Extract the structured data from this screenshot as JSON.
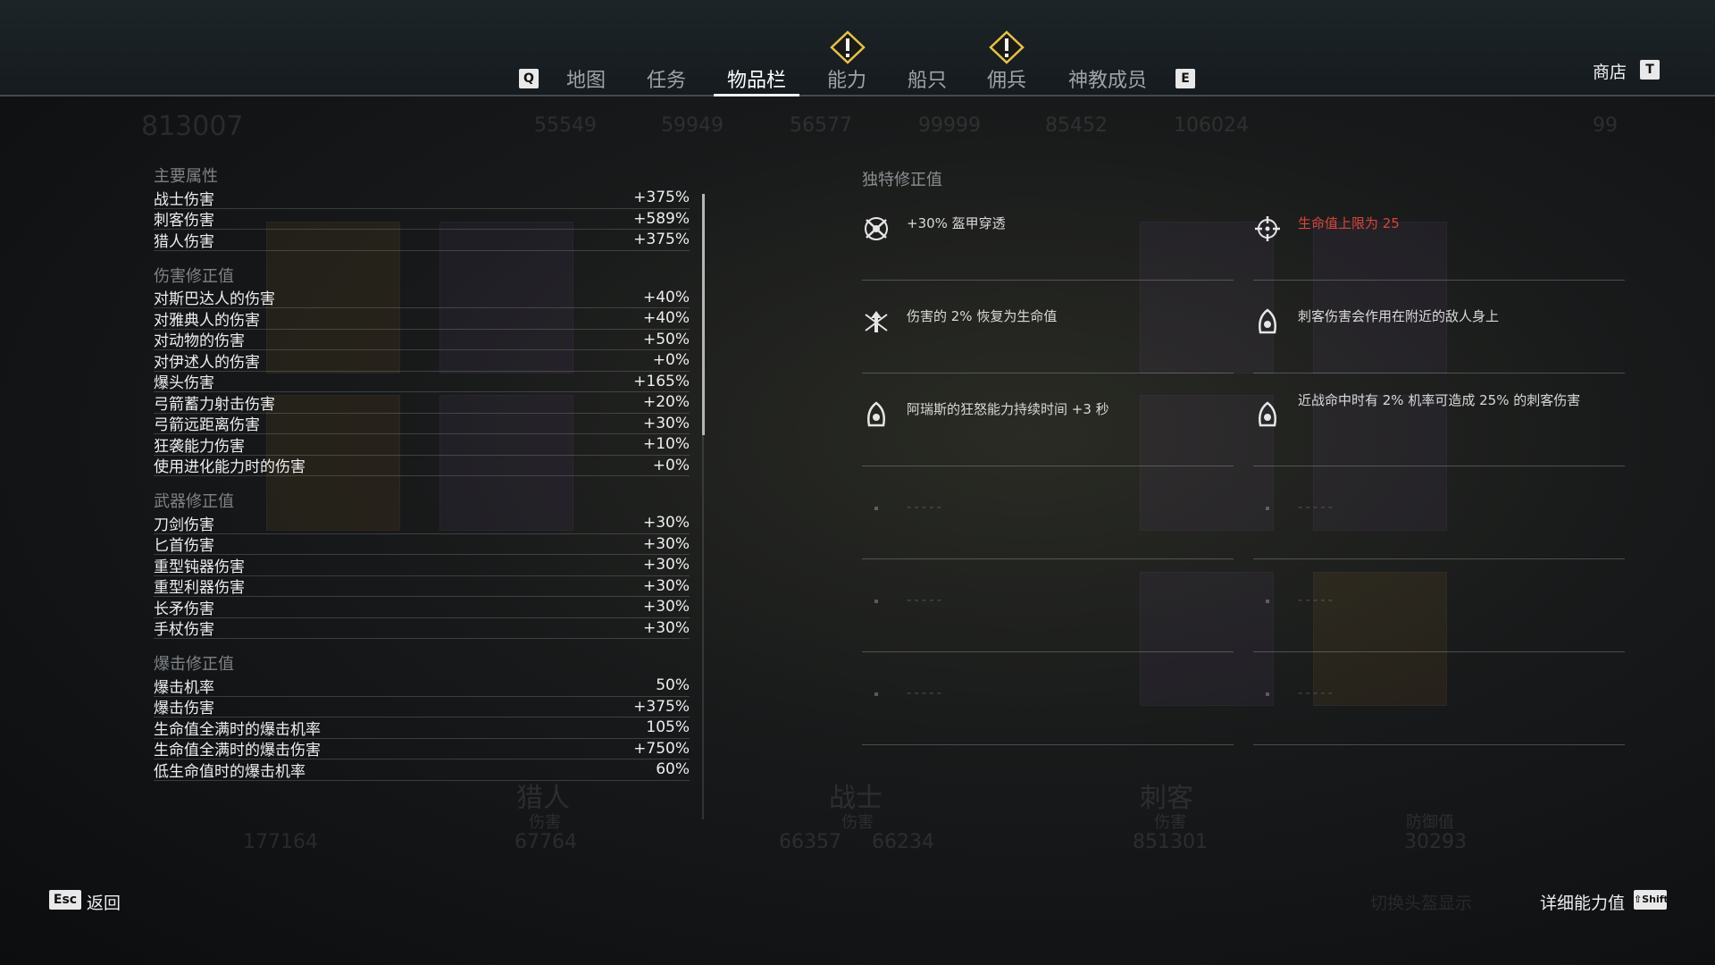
{
  "nav": {
    "left_key": "Q",
    "right_key": "E",
    "tabs": [
      {
        "label": "地图",
        "active": false,
        "alert": false
      },
      {
        "label": "任务",
        "active": false,
        "alert": false
      },
      {
        "label": "物品栏",
        "active": true,
        "alert": false
      },
      {
        "label": "能力",
        "active": false,
        "alert": true
      },
      {
        "label": "船只",
        "active": false,
        "alert": false
      },
      {
        "label": "佣兵",
        "active": false,
        "alert": true
      },
      {
        "label": "神教成员",
        "active": false,
        "alert": false
      }
    ],
    "shop_label": "商店",
    "shop_key": "T"
  },
  "background_stats": {
    "top": [
      "813007",
      "55549",
      "59949",
      "56577",
      "99999",
      "85452",
      "106024"
    ],
    "bottom_labels": [
      "猎人",
      "战士",
      "刺客"
    ],
    "bottom_sub": [
      "伤害",
      "伤害",
      "伤害",
      "防御值"
    ],
    "bottom_values": [
      "177164",
      "67764",
      "66357",
      "66234",
      "851301",
      "30293"
    ],
    "level_badge": "99"
  },
  "stats": {
    "sections": [
      {
        "title": "主要属性",
        "rows": [
          {
            "label": "战士伤害",
            "value": "+375%"
          },
          {
            "label": "刺客伤害",
            "value": "+589%"
          },
          {
            "label": "猎人伤害",
            "value": "+375%"
          }
        ]
      },
      {
        "title": "伤害修正值",
        "rows": [
          {
            "label": "对斯巴达人的伤害",
            "value": "+40%"
          },
          {
            "label": "对雅典人的伤害",
            "value": "+40%"
          },
          {
            "label": "对动物的伤害",
            "value": "+50%"
          },
          {
            "label": "对伊述人的伤害",
            "value": "+0%"
          },
          {
            "label": "爆头伤害",
            "value": "+165%"
          },
          {
            "label": "弓箭蓄力射击伤害",
            "value": "+20%"
          },
          {
            "label": "弓箭远距离伤害",
            "value": "+30%"
          },
          {
            "label": "狂袭能力伤害",
            "value": "+10%"
          },
          {
            "label": "使用进化能力时的伤害",
            "value": "+0%"
          }
        ]
      },
      {
        "title": "武器修正值",
        "rows": [
          {
            "label": "刀剑伤害",
            "value": "+30%"
          },
          {
            "label": "匕首伤害",
            "value": "+30%"
          },
          {
            "label": "重型钝器伤害",
            "value": "+30%"
          },
          {
            "label": "重型利器伤害",
            "value": "+30%"
          },
          {
            "label": "长矛伤害",
            "value": "+30%"
          },
          {
            "label": "手杖伤害",
            "value": "+30%"
          }
        ]
      },
      {
        "title": "爆击修正值",
        "rows": [
          {
            "label": "爆击机率",
            "value": "50%"
          },
          {
            "label": "爆击伤害",
            "value": "+375%"
          },
          {
            "label": "生命值全满时的爆击机率",
            "value": "105%"
          },
          {
            "label": "生命值全满时的爆击伤害",
            "value": "+750%"
          },
          {
            "label": "低生命值时的爆击机率",
            "value": "60%"
          }
        ]
      }
    ]
  },
  "unique_modifiers": {
    "title": "独特修正值",
    "items": [
      {
        "text": "+30% 盔甲穿透",
        "icon": "armor-pierce-icon",
        "warning": false
      },
      {
        "text": "生命值上限为 25",
        "icon": "crosshair-icon",
        "warning": true
      },
      {
        "text": "伤害的 2% 恢复为生命值",
        "icon": "warrior-heal-icon",
        "warning": false
      },
      {
        "text": "刺客伤害会作用在附近的敌人身上",
        "icon": "assassin-hood-icon",
        "warning": false
      },
      {
        "text": "阿瑞斯的狂怒能力持续时间 +3 秒",
        "icon": "assassin-hood-icon",
        "warning": false
      },
      {
        "text": "近战命中时有 2% 机率可造成 25% 的刺客伤害",
        "icon": "assassin-hood-icon",
        "warning": false
      },
      {
        "text": "-----",
        "empty": true
      },
      {
        "text": "-----",
        "empty": true
      },
      {
        "text": "-----",
        "empty": true
      },
      {
        "text": "-----",
        "empty": true
      },
      {
        "text": "-----",
        "empty": true
      },
      {
        "text": "-----",
        "empty": true
      }
    ]
  },
  "footer": {
    "esc_key": "Esc",
    "back_label": "返回",
    "toggle_helmet": "切换头盔显示",
    "detail_label": "详细能力值",
    "shift_key": "⇧Shift"
  },
  "colors": {
    "accent_white": "#f1f1f1",
    "warning_red": "#d8453a",
    "alert_yellow": "#e8c04a"
  }
}
